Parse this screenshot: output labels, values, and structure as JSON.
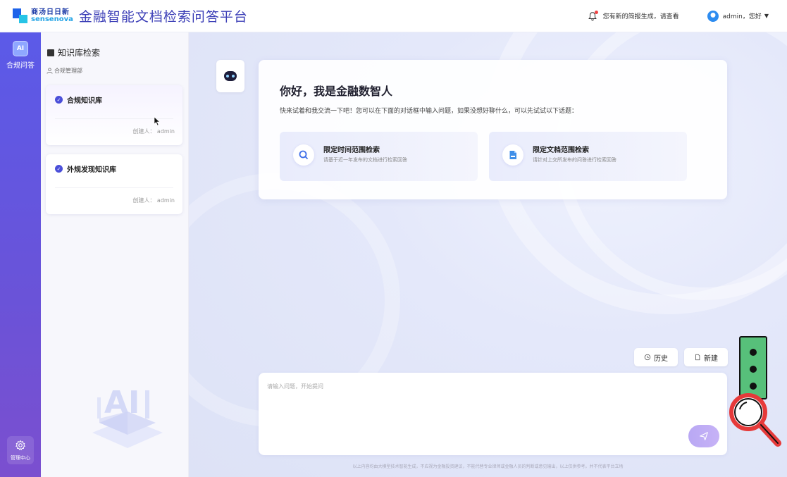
{
  "header": {
    "logo_cn": "商汤日日新",
    "logo_en": "sensenova",
    "app_title": "金融智能文档检索问答平台",
    "notification_text": "您有新的简报生成，请查看",
    "user_text": "admin，您好"
  },
  "rail": {
    "ai_badge": "AI",
    "compliance_qa_label": "合规问答",
    "admin_center_label": "管理中心"
  },
  "kb_sidebar": {
    "title": "知识库检索",
    "department": "合规管理部",
    "cards": [
      {
        "name": "合规知识库",
        "creator": "创建人： admin"
      },
      {
        "name": "外规发现知识库",
        "creator": "创建人： admin"
      }
    ]
  },
  "welcome": {
    "title": "你好，我是金融数智人",
    "subtitle": "快来试着和我交流一下吧！您可以在下面的对话框中输入问题，如果没想好聊什么，可以先试试以下话题：",
    "suggestions": [
      {
        "title": "限定时间范围检索",
        "desc": "请基于近一年发布的文档进行检索回答"
      },
      {
        "title": "限定文档范围检索",
        "desc": "请针对上交所发布的问答进行检索回答"
      }
    ]
  },
  "actions": {
    "history_label": "历史",
    "new_label": "新建"
  },
  "input": {
    "placeholder": "请输入问题，开始提问",
    "value": ""
  },
  "footer_note": "以上内容均由大模型技术智能生成，不应视为金融投资建议，不能代替专业律师或金融人员的判断或意见输出，以上仅供参考。并不代表平台立场",
  "colors": {
    "brand_primary": "#4b4fd9",
    "rail_gradient_top": "#5b5ae8",
    "rail_gradient_bottom": "#7b4fcf",
    "send_button": "#b9a8f4",
    "notification_dot": "#f04343"
  },
  "icons": {
    "notification": "bell-icon",
    "user": "user-avatar",
    "settings": "gear-icon",
    "search": "search-icon",
    "document": "document-icon",
    "history": "history-icon",
    "new": "new-chat-icon",
    "send": "send-icon",
    "magnifier": "magnifier-icon"
  }
}
